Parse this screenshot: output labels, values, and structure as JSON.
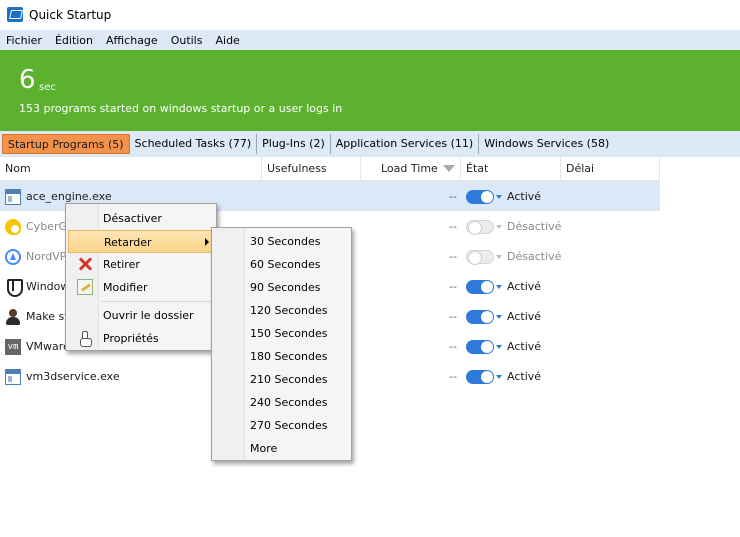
{
  "window": {
    "title": "Quick Startup"
  },
  "menu": [
    "Fichier",
    "Édition",
    "Affichage",
    "Outils",
    "Aide"
  ],
  "banner": {
    "value": "6",
    "unit": "sec",
    "subtitle": "153 programs started on windows startup or a user logs in",
    "color": "#5cb22f"
  },
  "tabs": [
    {
      "label": "Startup Programs (5)",
      "active": true
    },
    {
      "label": "Scheduled Tasks (77)",
      "active": false
    },
    {
      "label": "Plug-Ins (2)",
      "active": false
    },
    {
      "label": "Application Services (11)",
      "active": false
    },
    {
      "label": "Windows Services (58)",
      "active": false
    }
  ],
  "columns": [
    "Nom",
    "Usefulness",
    "Load Time",
    "État",
    "Délai"
  ],
  "rows": [
    {
      "name": "ace_engine.exe",
      "icon": "window-icon",
      "load": "--",
      "state": "Activé",
      "enabled": true,
      "selected": true
    },
    {
      "name": "CyberGh",
      "icon": "cyberghost-icon",
      "load": "--",
      "state": "Désactivé",
      "enabled": false,
      "selected": false
    },
    {
      "name": "NordVPN",
      "icon": "nordvpn-icon",
      "load": "--",
      "state": "Désactivé",
      "enabled": false,
      "selected": false
    },
    {
      "name": "Windows",
      "icon": "shield-icon",
      "load": "--",
      "state": "Activé",
      "enabled": true,
      "selected": false
    },
    {
      "name": "Make sta",
      "icon": "person-icon",
      "load": "--",
      "state": "Activé",
      "enabled": true,
      "selected": false
    },
    {
      "name": "VMware",
      "icon": "vmware-icon",
      "load": "--",
      "state": "Activé",
      "enabled": true,
      "selected": false
    },
    {
      "name": "vm3dservice.exe",
      "icon": "window-icon",
      "load": "--",
      "state": "Activé",
      "enabled": true,
      "selected": false
    }
  ],
  "vmware_icon_text": "vm",
  "context_menu": {
    "items": [
      {
        "label": "Désactiver",
        "icon": ""
      },
      {
        "label": "Retarder",
        "icon": "",
        "submenu": true,
        "highlighted": true
      },
      {
        "label": "Retirer",
        "icon": "remove-icon"
      },
      {
        "label": "Modifier",
        "icon": "edit-icon"
      },
      {
        "label": "Ouvrir le dossier",
        "icon": ""
      },
      {
        "label": "Propriétés",
        "icon": "properties-icon"
      }
    ]
  },
  "submenu": {
    "items": [
      "30 Secondes",
      "60 Secondes",
      "90 Secondes",
      "120 Secondes",
      "150 Secondes",
      "180 Secondes",
      "210 Secondes",
      "240 Secondes",
      "270 Secondes",
      "More"
    ]
  }
}
